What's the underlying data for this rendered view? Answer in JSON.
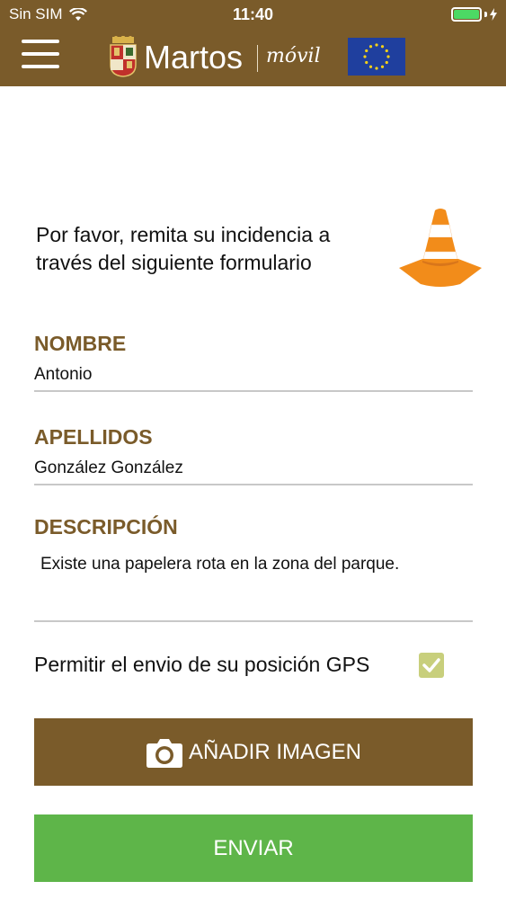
{
  "status_bar": {
    "carrier": "Sin SIM",
    "time": "11:40"
  },
  "header": {
    "brand": "Martos",
    "brand_sub": "móvil"
  },
  "intro_text": "Por favor, remita su incidencia a través del siguiente formulario",
  "form": {
    "nombre": {
      "label": "NOMBRE",
      "value": "Antonio"
    },
    "apellidos": {
      "label": "APELLIDOS",
      "value": "González González"
    },
    "descripcion": {
      "label": "DESCRIPCIÓN",
      "value": "Existe una papelera rota en la zona del parque."
    },
    "gps": {
      "label": "Permitir el envio de su posición GPS",
      "checked": true
    }
  },
  "buttons": {
    "add_image": "AÑADIR IMAGEN",
    "send": "ENVIAR"
  },
  "colors": {
    "brand_brown": "#7a5b2a",
    "send_green": "#5eb549",
    "checkbox": "#c8cf7c",
    "cone_orange": "#f28c1a"
  }
}
